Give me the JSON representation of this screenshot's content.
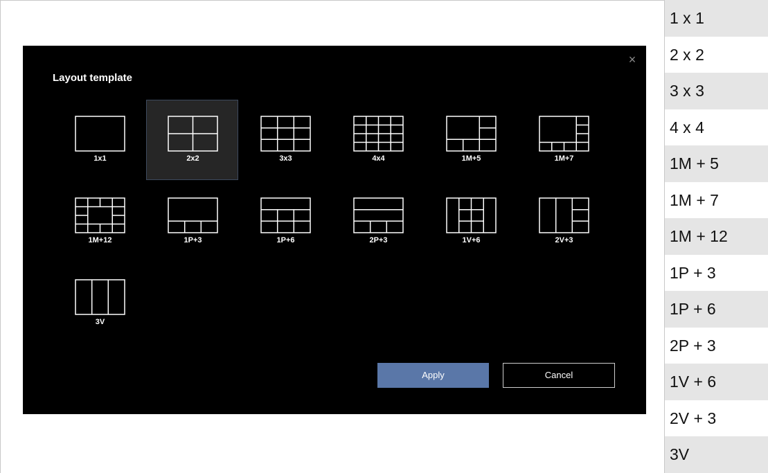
{
  "dialog": {
    "title": "Layout template",
    "close_glyph": "×",
    "apply_label": "Apply",
    "cancel_label": "Cancel",
    "selected": "2x2",
    "templates": [
      {
        "label": "1x1",
        "icon": "layout-1x1-icon"
      },
      {
        "label": "2x2",
        "icon": "layout-2x2-icon"
      },
      {
        "label": "3x3",
        "icon": "layout-3x3-icon"
      },
      {
        "label": "4x4",
        "icon": "layout-4x4-icon"
      },
      {
        "label": "1M+5",
        "icon": "layout-1m5-icon"
      },
      {
        "label": "1M+7",
        "icon": "layout-1m7-icon"
      },
      {
        "label": "1M+12",
        "icon": "layout-1m12-icon"
      },
      {
        "label": "1P+3",
        "icon": "layout-1p3-icon"
      },
      {
        "label": "1P+6",
        "icon": "layout-1p6-icon"
      },
      {
        "label": "2P+3",
        "icon": "layout-2p3-icon"
      },
      {
        "label": "1V+6",
        "icon": "layout-1v6-icon"
      },
      {
        "label": "2V+3",
        "icon": "layout-2v3-icon"
      },
      {
        "label": "3V",
        "icon": "layout-3v-icon"
      }
    ]
  },
  "legend": [
    "1 x 1",
    "2 x 2",
    "3 x 3",
    "4 x 4",
    "1M + 5",
    "1M + 7",
    "1M + 12",
    "1P + 3",
    "1P + 6",
    "2P + 3",
    "1V + 6",
    "2V + 3",
    "3V"
  ],
  "colors": {
    "dialog_bg": "#000000",
    "apply_bg": "#5a77a8",
    "selected_bg": "#262626",
    "legend_shade": "#e5e5e5"
  }
}
